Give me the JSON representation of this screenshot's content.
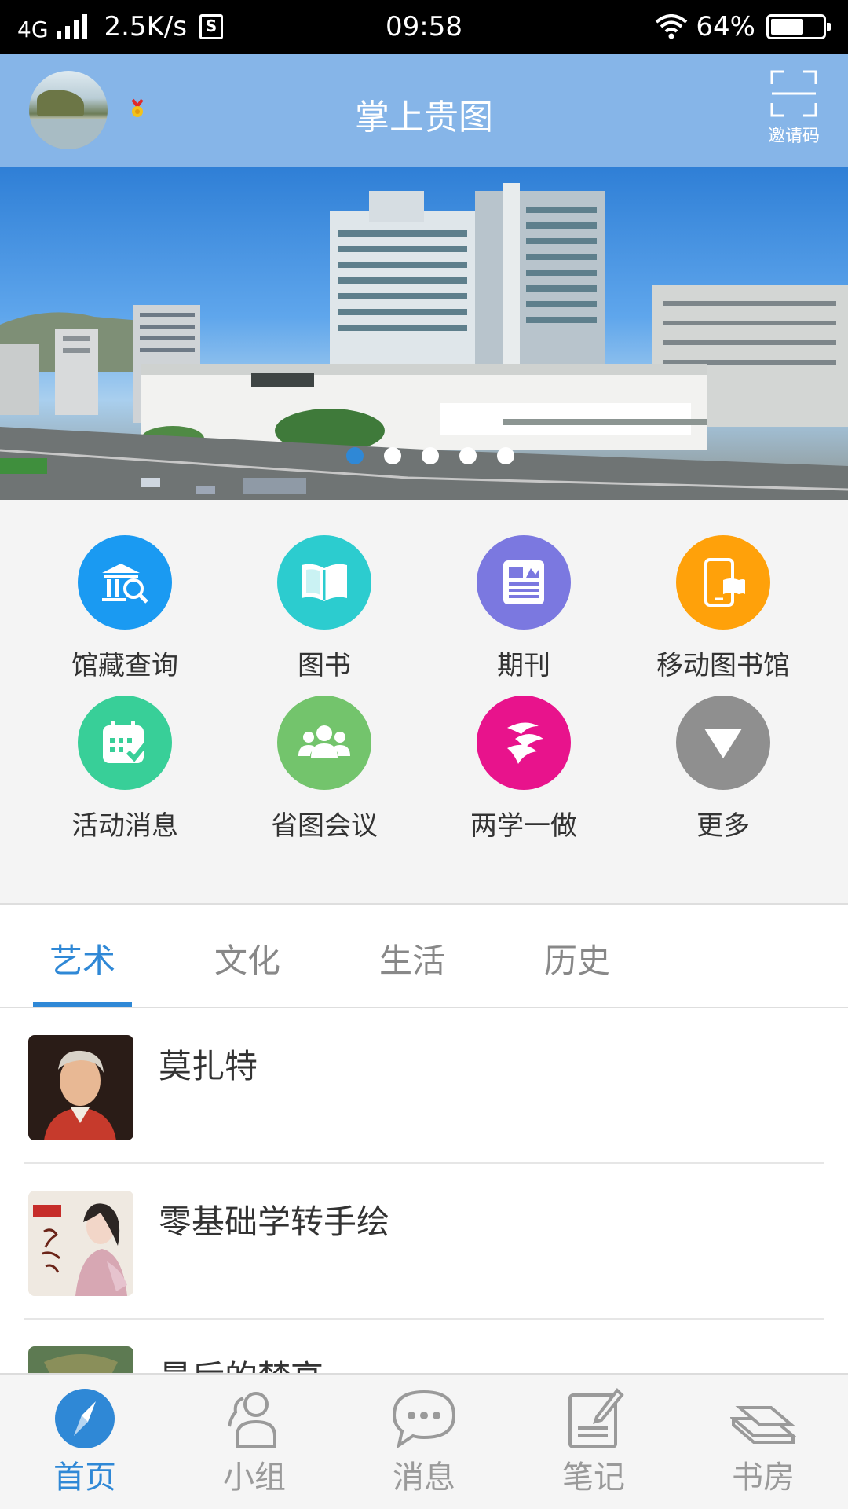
{
  "status_bar": {
    "network": "4G",
    "speed": "2.5K/s",
    "sim_badge": "S",
    "time": "09:58",
    "battery_percent": "64%",
    "battery_level": 0.64
  },
  "header": {
    "title": "掌上贵图",
    "invite_label": "邀请码"
  },
  "banner": {
    "slide_count": 5,
    "active_slide": 0
  },
  "quick_menu": [
    {
      "label": "馆藏查询",
      "color": "#1a9af2",
      "icon": "library-search-icon"
    },
    {
      "label": "图书",
      "color": "#2ccccf",
      "icon": "open-book-icon"
    },
    {
      "label": "期刊",
      "color": "#7b78e0",
      "icon": "newspaper-icon"
    },
    {
      "label": "移动图书馆",
      "color": "#ffa10a",
      "icon": "mobile-library-icon"
    },
    {
      "label": "活动消息",
      "color": "#38cf98",
      "icon": "calendar-check-icon"
    },
    {
      "label": "省图会议",
      "color": "#73c46c",
      "icon": "people-group-icon"
    },
    {
      "label": "两学一做",
      "color": "#e8138c",
      "icon": "emblem-icon"
    },
    {
      "label": "更多",
      "color": "#8f8f8f",
      "icon": "triangle-down-icon"
    }
  ],
  "tabs": [
    {
      "label": "艺术",
      "active": true
    },
    {
      "label": "文化",
      "active": false
    },
    {
      "label": "生活",
      "active": false
    },
    {
      "label": "历史",
      "active": false
    }
  ],
  "list": [
    {
      "title": "莫扎特"
    },
    {
      "title": "零基础学转手绘"
    },
    {
      "title": "最后的梵高"
    }
  ],
  "bottom_nav": [
    {
      "label": "首页",
      "icon": "compass-icon",
      "active": true
    },
    {
      "label": "小组",
      "icon": "group-icon",
      "active": false
    },
    {
      "label": "消息",
      "icon": "chat-bubble-icon",
      "active": false
    },
    {
      "label": "笔记",
      "icon": "note-edit-icon",
      "active": false
    },
    {
      "label": "书房",
      "icon": "bookshelf-icon",
      "active": false
    }
  ],
  "colors": {
    "accent": "#2f88d6",
    "header_bg": "#86b5e8",
    "inactive_text": "#9a9a9a"
  }
}
